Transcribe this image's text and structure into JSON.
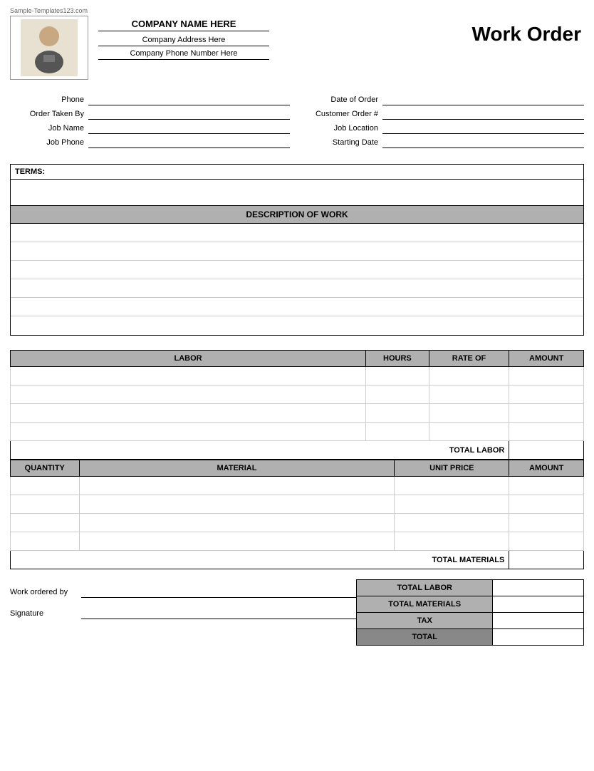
{
  "watermark": "Sample-Templates123.com",
  "header": {
    "company_name": "COMPANY NAME HERE",
    "company_address": "Company Address Here",
    "company_phone": "Company Phone Number Here",
    "title": "Work Order"
  },
  "form": {
    "phone_label": "Phone",
    "order_taken_by_label": "Order Taken By",
    "job_name_label": "Job Name",
    "job_phone_label": "Job Phone",
    "date_of_order_label": "Date of Order",
    "customer_order_label": "Customer Order #",
    "job_location_label": "Job Location",
    "starting_date_label": "Starting Date"
  },
  "terms": {
    "label": "TERMS:"
  },
  "description": {
    "header": "DESCRIPTION OF WORK",
    "rows": 6
  },
  "labor": {
    "col_labor": "LABOR",
    "col_hours": "HOURS",
    "col_rate": "RATE OF",
    "col_amount": "AMOUNT",
    "rows": 4,
    "total_label": "TOTAL LABOR"
  },
  "materials": {
    "col_qty": "QUANTITY",
    "col_material": "MATERIAL",
    "col_unit_price": "UNIT PRICE",
    "col_amount": "AMOUNT",
    "rows": 4,
    "total_label": "TOTAL MATERIALS"
  },
  "summary": {
    "total_labor_label": "TOTAL LABOR",
    "total_materials_label": "TOTAL MATERIALS",
    "tax_label": "TAX",
    "total_label": "TOTAL"
  },
  "signature": {
    "work_ordered_by_label": "Work ordered by",
    "signature_label": "Signature"
  }
}
